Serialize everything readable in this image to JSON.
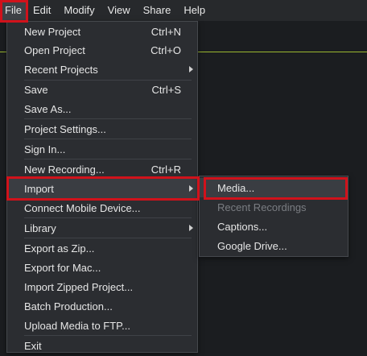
{
  "menubar": {
    "items": [
      {
        "label": "File"
      },
      {
        "label": "Edit"
      },
      {
        "label": "Modify"
      },
      {
        "label": "View"
      },
      {
        "label": "Share"
      },
      {
        "label": "Help"
      }
    ]
  },
  "file_menu": {
    "new_project": {
      "label": "New Project",
      "shortcut": "Ctrl+N"
    },
    "open_project": {
      "label": "Open Project",
      "shortcut": "Ctrl+O"
    },
    "recent_projects": {
      "label": "Recent Projects"
    },
    "save": {
      "label": "Save",
      "shortcut": "Ctrl+S"
    },
    "save_as": {
      "label": "Save As..."
    },
    "project_settings": {
      "label": "Project Settings..."
    },
    "sign_in": {
      "label": "Sign In..."
    },
    "new_recording": {
      "label": "New Recording...",
      "shortcut": "Ctrl+R"
    },
    "import": {
      "label": "Import"
    },
    "connect_mobile": {
      "label": "Connect Mobile Device..."
    },
    "library": {
      "label": "Library"
    },
    "export_zip": {
      "label": "Export as Zip..."
    },
    "export_mac": {
      "label": "Export for Mac..."
    },
    "import_zipped": {
      "label": "Import Zipped Project..."
    },
    "batch_production": {
      "label": "Batch Production..."
    },
    "upload_ftp": {
      "label": "Upload Media to FTP..."
    },
    "exit": {
      "label": "Exit"
    }
  },
  "import_submenu": {
    "media": {
      "label": "Media..."
    },
    "recent_recordings": {
      "label": "Recent Recordings"
    },
    "captions": {
      "label": "Captions..."
    },
    "google_drive": {
      "label": "Google Drive..."
    }
  },
  "colors": {
    "highlight": "#d0121b",
    "accent_line": "#9bb82f",
    "menu_bg": "#2b2d31"
  }
}
